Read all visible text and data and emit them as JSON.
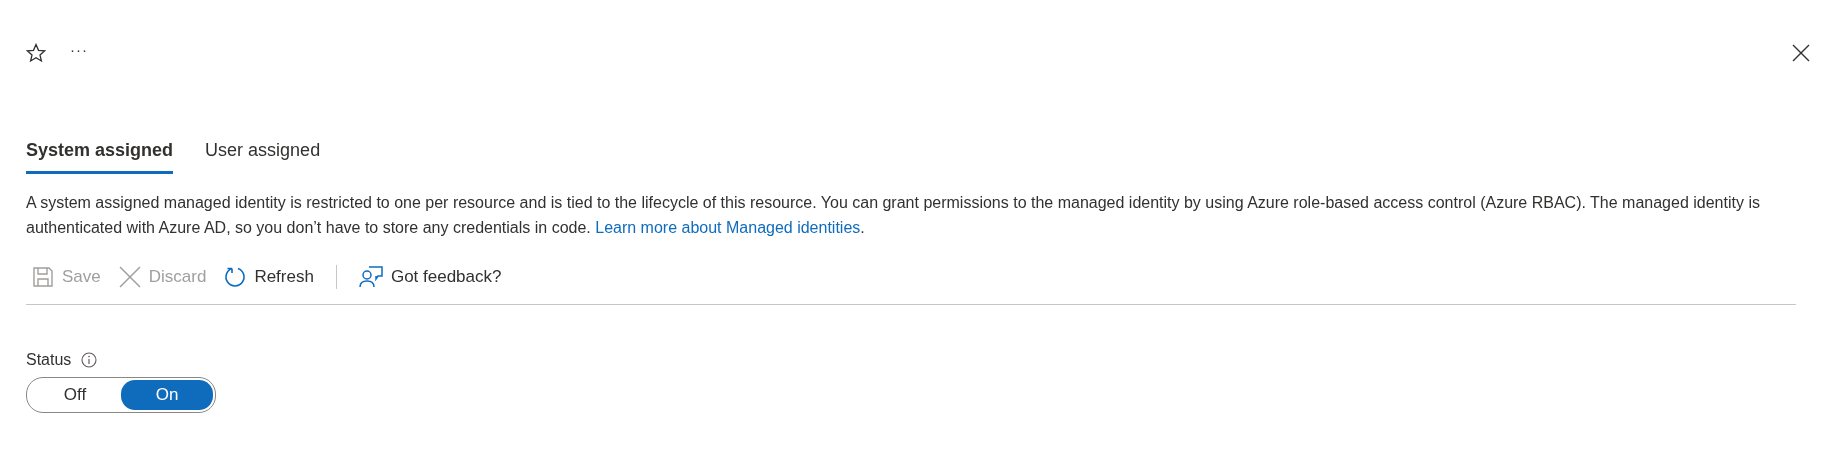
{
  "header": {
    "more": "···"
  },
  "tabs": [
    {
      "label": "System assigned",
      "selected": true
    },
    {
      "label": "User assigned",
      "selected": false
    }
  ],
  "description": {
    "text": "A system assigned managed identity is restricted to one per resource and is tied to the lifecycle of this resource. You can grant permissions to the managed identity by using Azure role-based access control (Azure RBAC). The managed identity is authenticated with Azure AD, so you don’t have to store any credentials in code.",
    "link": "Learn more about Managed identities",
    "after": "."
  },
  "toolbar": [
    {
      "kind": "save",
      "label": "Save",
      "disabled": true
    },
    {
      "kind": "discard",
      "label": "Discard",
      "disabled": true
    },
    {
      "kind": "refresh",
      "label": "Refresh",
      "disabled": false
    },
    {
      "kind": "feedback",
      "label": "Got feedback?",
      "disabled": false
    }
  ],
  "status": {
    "label": "Status",
    "options": [
      {
        "label": "Off",
        "selected": false
      },
      {
        "label": "On",
        "selected": true
      }
    ]
  }
}
